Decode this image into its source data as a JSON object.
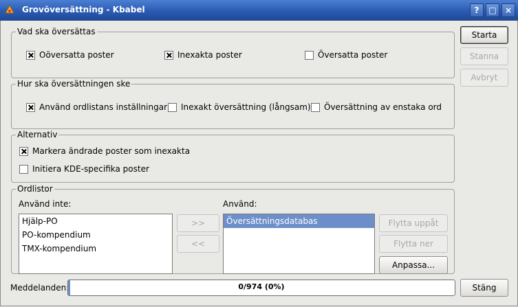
{
  "window": {
    "title": "Grovöversättning - Kbabel",
    "buttons": {
      "help": "?",
      "maximize": "□",
      "close": "×"
    }
  },
  "groups": {
    "what": {
      "title": "Vad ska översättas",
      "options": [
        {
          "label": "Oöversatta poster",
          "checked": true
        },
        {
          "label": "Inexakta poster",
          "checked": true
        },
        {
          "label": "Översatta poster",
          "checked": false
        }
      ]
    },
    "how": {
      "title": "Hur ska översättningen ske",
      "options": [
        {
          "label": "Använd ordlistans inställningar",
          "checked": true
        },
        {
          "label": "Inexakt översättning (långsam)",
          "checked": false
        },
        {
          "label": "Översättning av enstaka ord",
          "checked": false
        }
      ]
    },
    "options": {
      "title": "Alternativ",
      "options": [
        {
          "label": "Markera ändrade poster som inexakta",
          "checked": true
        },
        {
          "label": "Initiera KDE-specifika poster",
          "checked": false
        }
      ]
    },
    "dictionaries": {
      "title": "Ordlistor",
      "unused_label": "Använd inte:",
      "used_label": "Använd:",
      "unused_items": [
        "Hjälp-PO",
        "PO-kompendium",
        "TMX-kompendium"
      ],
      "used_items": [
        "Översättningsdatabas"
      ],
      "add_label": ">>",
      "remove_label": "<<",
      "move_up_label": "Flytta uppåt",
      "move_down_label": "Flytta ner",
      "customize_label": "Anpassa..."
    }
  },
  "side_buttons": {
    "start": "Starta",
    "stop": "Stanna",
    "cancel": "Avbryt"
  },
  "status": {
    "label": "Meddelanden:",
    "progress_text": "0/974 (0%)",
    "progress_fraction": 0.0
  },
  "close_button": "Stäng"
}
